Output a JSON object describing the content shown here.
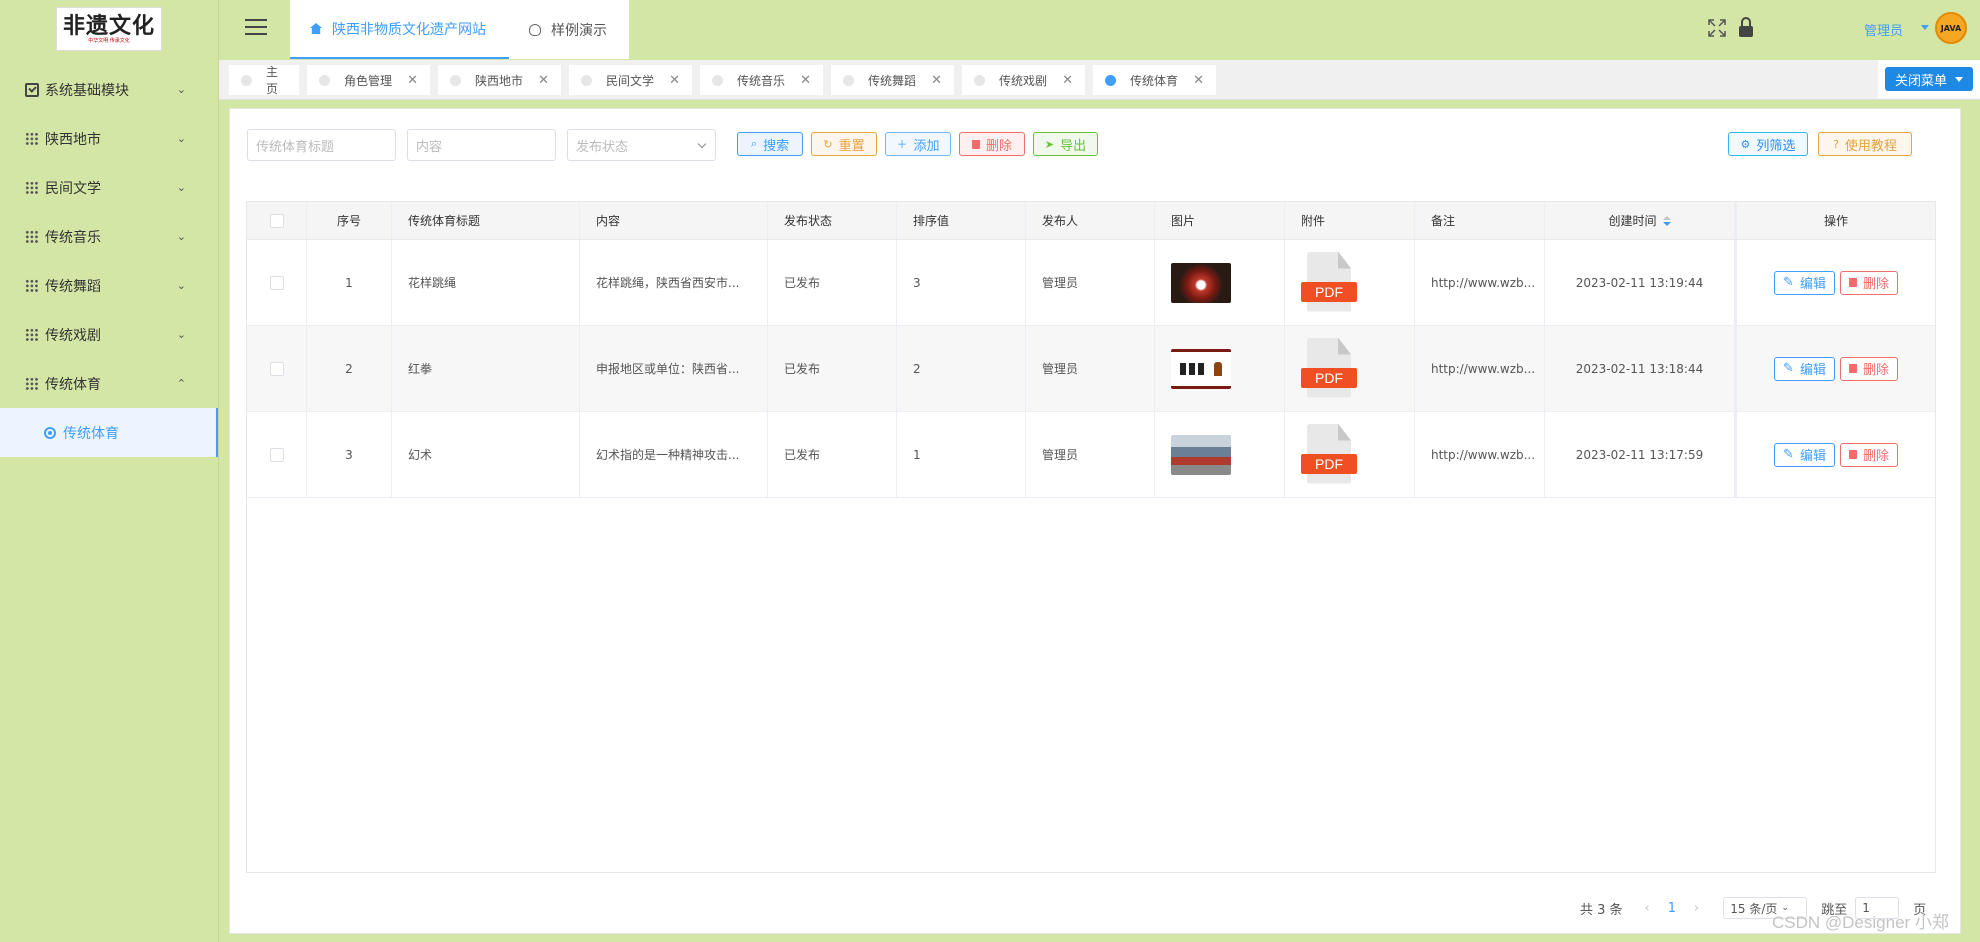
{
  "app": {
    "logo_text": "非遗文化",
    "logo_sub": "中华文明 传承文化",
    "top_tabs": [
      {
        "label": "陕西非物质文化遗产网站"
      },
      {
        "label": "样例演示"
      }
    ],
    "user": {
      "name": "管理员",
      "avatar_text": "JAVA"
    }
  },
  "sidebar": {
    "items": [
      {
        "label": "系统基础模块",
        "icon": "checkbox-icon",
        "chevron": "⌄"
      },
      {
        "label": "陕西地市",
        "icon": "grid-icon",
        "chevron": "⌄"
      },
      {
        "label": "民间文学",
        "icon": "grid-icon",
        "chevron": "⌄"
      },
      {
        "label": "传统音乐",
        "icon": "grid-icon",
        "chevron": "⌄"
      },
      {
        "label": "传统舞蹈",
        "icon": "grid-icon",
        "chevron": "⌄"
      },
      {
        "label": "传统戏剧",
        "icon": "grid-icon",
        "chevron": "⌄"
      },
      {
        "label": "传统体育",
        "icon": "grid-icon",
        "chevron": "⌃"
      }
    ],
    "active_sub": "传统体育"
  },
  "page_tabs": [
    {
      "label": "主页",
      "closable": false
    },
    {
      "label": "角色管理",
      "closable": true
    },
    {
      "label": "陕西地市",
      "closable": true
    },
    {
      "label": "民间文学",
      "closable": true
    },
    {
      "label": "传统音乐",
      "closable": true
    },
    {
      "label": "传统舞蹈",
      "closable": true
    },
    {
      "label": "传统戏剧",
      "closable": true
    },
    {
      "label": "传统体育",
      "closable": true,
      "active": true
    }
  ],
  "close_menu_label": "关闭菜单",
  "filters": {
    "title_placeholder": "传统体育标题",
    "content_placeholder": "内容",
    "status_placeholder": "发布状态"
  },
  "toolbar": {
    "search": "搜索",
    "reset": "重置",
    "add": "添加",
    "delete": "删除",
    "export": "导出",
    "column_filter": "列筛选",
    "tutorial": "使用教程"
  },
  "table": {
    "columns": [
      "序号",
      "传统体育标题",
      "内容",
      "发布状态",
      "排序值",
      "发布人",
      "图片",
      "附件",
      "备注",
      "创建时间",
      "操作"
    ],
    "rows": [
      {
        "index": "1",
        "title": "花样跳绳",
        "content": "花样跳绳，陕西省西安市...",
        "status": "已发布",
        "sort": "3",
        "publisher": "管理员",
        "attachment": "PDF",
        "remark": "http://www.wzb...",
        "created": "2023-02-11 13:19:44"
      },
      {
        "index": "2",
        "title": "红拳",
        "content": "申报地区或单位：陕西省...",
        "status": "已发布",
        "sort": "2",
        "publisher": "管理员",
        "attachment": "PDF",
        "remark": "http://www.wzb...",
        "created": "2023-02-11 13:18:44"
      },
      {
        "index": "3",
        "title": "幻术",
        "content": "幻术指的是一种精神攻击...",
        "status": "已发布",
        "sort": "1",
        "publisher": "管理员",
        "attachment": "PDF",
        "remark": "http://www.wzb...",
        "created": "2023-02-11 13:17:59"
      }
    ],
    "edit_label": "编辑",
    "delete_label": "删除"
  },
  "pagination": {
    "total": "共 3 条",
    "current": "1",
    "page_size": "15 条/页",
    "jump_label": "跳至",
    "jump_value": "1",
    "page_unit": "页"
  },
  "watermark": "CSDN @Designer 小郑",
  "colors": {
    "accent": "#409eff",
    "danger": "#f56c6c",
    "sidebar_bg": "#d4e6a5",
    "pdf_red": "#f04e23"
  }
}
